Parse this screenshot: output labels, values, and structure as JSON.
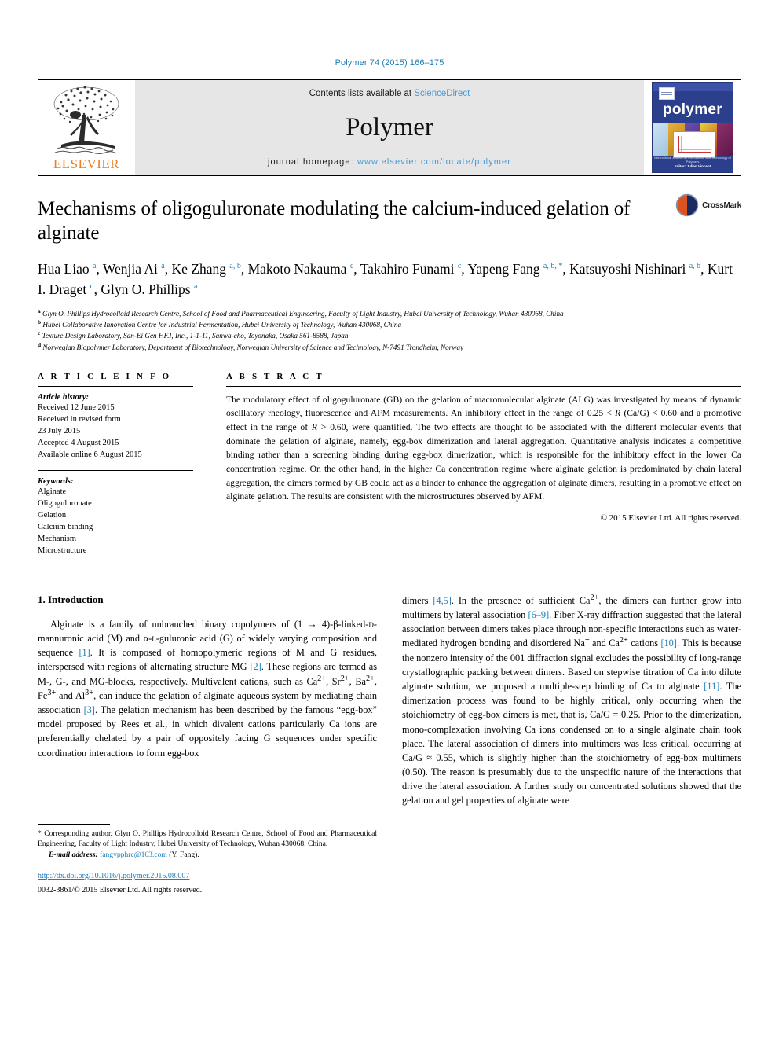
{
  "running_head": "Polymer 74 (2015) 166–175",
  "masthead": {
    "publisher": "ELSEVIER",
    "contents_prefix": "Contents lists available at ",
    "contents_link": "ScienceDirect",
    "journal_name": "Polymer",
    "homepage_prefix": "journal homepage: ",
    "homepage_url": "www.elsevier.com/locate/polymer",
    "cover_title": "polymer",
    "cover_footer_small": "International Journal for the Science and Technology of Polymers",
    "cover_footer_bold": "Editor: Julian Vincent"
  },
  "article": {
    "title": "Mechanisms of oligoguluronate modulating the calcium-induced gelation of alginate",
    "crossmark_label": "CrossMark",
    "authors": [
      {
        "name": "Hua Liao",
        "marks": "a"
      },
      {
        "name": "Wenjia Ai",
        "marks": "a"
      },
      {
        "name": "Ke Zhang",
        "marks": "a, b"
      },
      {
        "name": "Makoto Nakauma",
        "marks": "c"
      },
      {
        "name": "Takahiro Funami",
        "marks": "c"
      },
      {
        "name": "Yapeng Fang",
        "marks": "a, b, *"
      },
      {
        "name": "Katsuyoshi Nishinari",
        "marks": "a, b"
      },
      {
        "name": "Kurt I. Draget",
        "marks": "d"
      },
      {
        "name": "Glyn O. Phillips",
        "marks": "a"
      }
    ],
    "affiliations": [
      {
        "mark": "a",
        "text": "Glyn O. Phillips Hydrocolloid Research Centre, School of Food and Pharmaceutical Engineering, Faculty of Light Industry, Hubei University of Technology, Wuhan 430068, China"
      },
      {
        "mark": "b",
        "text": "Hubei Collaborative Innovation Centre for Industrial Fermentation, Hubei University of Technology, Wuhan 430068, China"
      },
      {
        "mark": "c",
        "text": "Texture Design Laboratory, San-Ei Gen F.F.I, Inc., 1-1-11, Sanwa-cho, Toyonaka, Osaka 561-8588, Japan"
      },
      {
        "mark": "d",
        "text": "Norwegian Biopolymer Laboratory, Department of Biotechnology, Norwegian University of Science and Technology, N-7491 Trondheim, Norway"
      }
    ]
  },
  "article_info": {
    "heading": "A R T I C L E   I N F O",
    "history_label": "Article history:",
    "history": [
      "Received 12 June 2015",
      "Received in revised form",
      "23 July 2015",
      "Accepted 4 August 2015",
      "Available online 6 August 2015"
    ],
    "keywords_label": "Keywords:",
    "keywords": [
      "Alginate",
      "Oligoguluronate",
      "Gelation",
      "Calcium binding",
      "Mechanism",
      "Microstructure"
    ]
  },
  "abstract": {
    "heading": "A B S T R A C T",
    "text": "The modulatory effect of oligoguluronate (GB) on the gelation of macromolecular alginate (ALG) was investigated by means of dynamic oscillatory rheology, fluorescence and AFM measurements. An inhibitory effect in the range of 0.25 < R (Ca/G) < 0.60 and a promotive effect in the range of R > 0.60, were quantified. The two effects are thought to be associated with the different molecular events that dominate the gelation of alginate, namely, egg-box dimerization and lateral aggregation. Quantitative analysis indicates a competitive binding rather than a screening binding during egg-box dimerization, which is responsible for the inhibitory effect in the lower Ca concentration regime. On the other hand, in the higher Ca concentration regime where alginate gelation is predominated by chain lateral aggregation, the dimers formed by GB could act as a binder to enhance the aggregation of alginate dimers, resulting in a promotive effect on alginate gelation. The results are consistent with the microstructures observed by AFM.",
    "copyright": "© 2015 Elsevier Ltd. All rights reserved."
  },
  "introduction": {
    "section_number_title": "1. Introduction",
    "left_paragraph_html": "Alginate is a family of unbranched binary copolymers of (1 → 4)-β-linked-<span style=\"font-variant:small-caps\">d</span>-mannuronic acid (M) and α-<span style=\"font-variant:small-caps\">l</span>-guluronic acid (G) of widely varying composition and sequence <span class=\"cite\">[1]</span>. It is composed of homopolymeric regions of M and G residues, interspersed with regions of alternating structure MG <span class=\"cite\">[2]</span>. These regions are termed as M-, G-, and MG-blocks, respectively. Multivalent cations, such as Ca<sup>2+</sup>, Sr<sup>2+</sup>, Ba<sup>2+</sup>, Fe<sup>3+</sup> and Al<sup>3+</sup>, can induce the gelation of alginate aqueous system by mediating chain association <span class=\"cite\">[3]</span>. The gelation mechanism has been described by the famous “egg-box” model proposed by Rees et al., in which divalent cations particularly Ca ions are preferentially chelated by a pair of oppositely facing G sequences under specific coordination interactions to form egg-box",
    "right_paragraph_html": "dimers <span class=\"cite\">[4,5]</span>. In the presence of sufficient Ca<sup>2+</sup>, the dimers can further grow into multimers by lateral association <span class=\"cite\">[6–9]</span>. Fiber X-ray diffraction suggested that the lateral association between dimers takes place through non-specific interactions such as water-mediated hydrogen bonding and disordered Na<sup>+</sup> and Ca<sup>2+</sup> cations <span class=\"cite\">[10]</span>. This is because the nonzero intensity of the 001 diffraction signal excludes the possibility of long-range crystallographic packing between dimers. Based on stepwise titration of Ca into dilute alginate solution, we proposed a multiple-step binding of Ca to alginate <span class=\"cite\">[11]</span>. The dimerization process was found to be highly critical, only occurring when the stoichiometry of egg-box dimers is met, that is, Ca/G = 0.25. Prior to the dimerization, mono-complexation involving Ca ions condensed on to a single alginate chain took place. The lateral association of dimers into multimers was less critical, occurring at Ca/G ≈ 0.55, which is slightly higher than the stoichiometry of egg-box multimers (0.50). The reason is presumably due to the unspecific nature of the interactions that drive the lateral association. A further study on concentrated solutions showed that the gelation and gel properties of alginate were"
  },
  "footnote": {
    "corresponding_html": "* Corresponding author. Glyn O. Phillips Hydrocolloid Research Centre, School of Food and Pharmaceutical Engineering, Faculty of Light Industry, Hubei University of Technology, Wuhan 430068, China.",
    "email_label": "E-mail address:",
    "email": "fangypphrc@163.com",
    "email_suffix": "(Y. Fang).",
    "doi": "http://dx.doi.org/10.1016/j.polymer.2015.08.007",
    "issn_copyright": "0032-3861/© 2015 Elsevier Ltd. All rights reserved."
  },
  "colors": {
    "link_blue": "#1f7eb5",
    "elsevier_orange": "#ef7d22",
    "masthead_gray": "#e6e6e6",
    "cover_blue": "#2b3f8c"
  }
}
